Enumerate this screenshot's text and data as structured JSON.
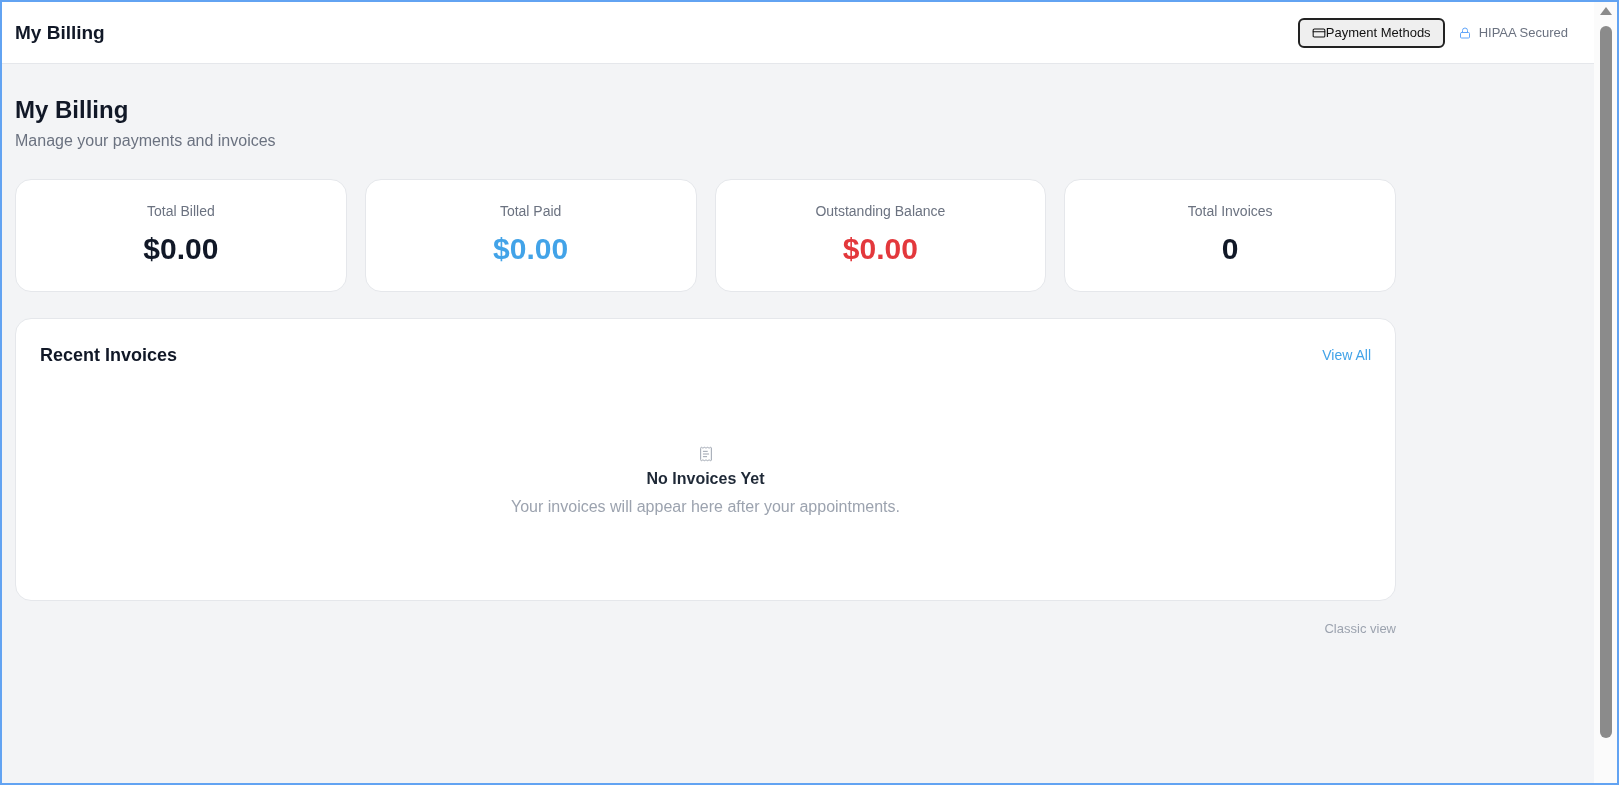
{
  "header": {
    "title": "My Billing",
    "payment_methods_button": "Payment Methods",
    "security_badge": "HIPAA Secured"
  },
  "page": {
    "title": "My Billing",
    "subtitle": "Manage your payments and invoices"
  },
  "stats": [
    {
      "label": "Total Billed",
      "value": "$0.00",
      "color": "#111827"
    },
    {
      "label": "Total Paid",
      "value": "$0.00",
      "color": "#42a3e8"
    },
    {
      "label": "Outstanding Balance",
      "value": "$0.00",
      "color": "#e3383c"
    },
    {
      "label": "Total Invoices",
      "value": "0",
      "color": "#111827"
    }
  ],
  "recent_invoices": {
    "title": "Recent Invoices",
    "view_all": "View All",
    "empty_state": {
      "title": "No Invoices Yet",
      "message": "Your invoices will appear here after your appointments."
    }
  },
  "footer": {
    "classic_view_link": "Classic view"
  }
}
